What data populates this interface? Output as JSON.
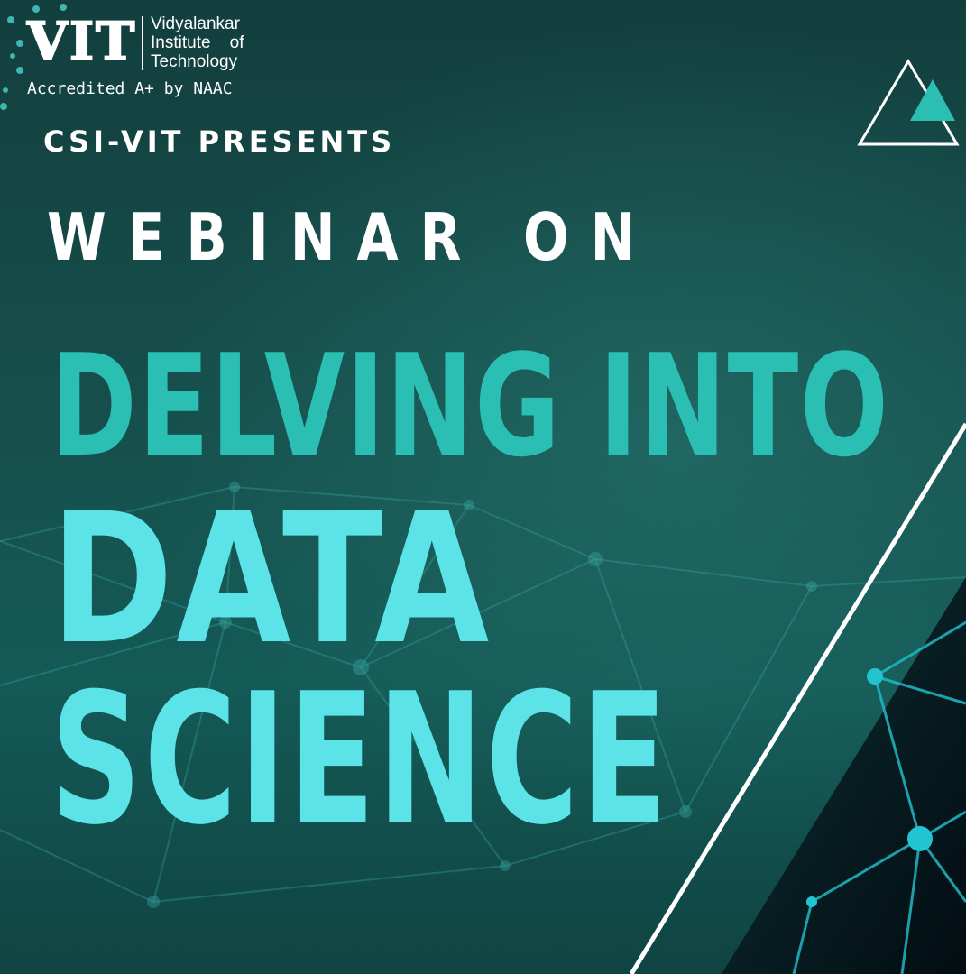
{
  "logo": {
    "abbr": "VIT",
    "name_lines": [
      "Vidyalankar",
      "Institute    of",
      "Technology"
    ],
    "accreditation": "Accredited A+ by NAAC"
  },
  "event": {
    "presenter": "CSI-VIT PRESENTS",
    "kicker": "WEBINAR ON",
    "title_line1": "DELVING INTO",
    "title_line2": "DATA",
    "title_line3": "SCIENCE"
  },
  "colors": {
    "background": "#144644",
    "title_teal": "#2bbfb3",
    "title_cyan": "#5ce3e8",
    "accent": "#2bbfb3",
    "text": "#ffffff"
  },
  "icons": [
    "triangle-logo-icon",
    "network-background-image"
  ]
}
